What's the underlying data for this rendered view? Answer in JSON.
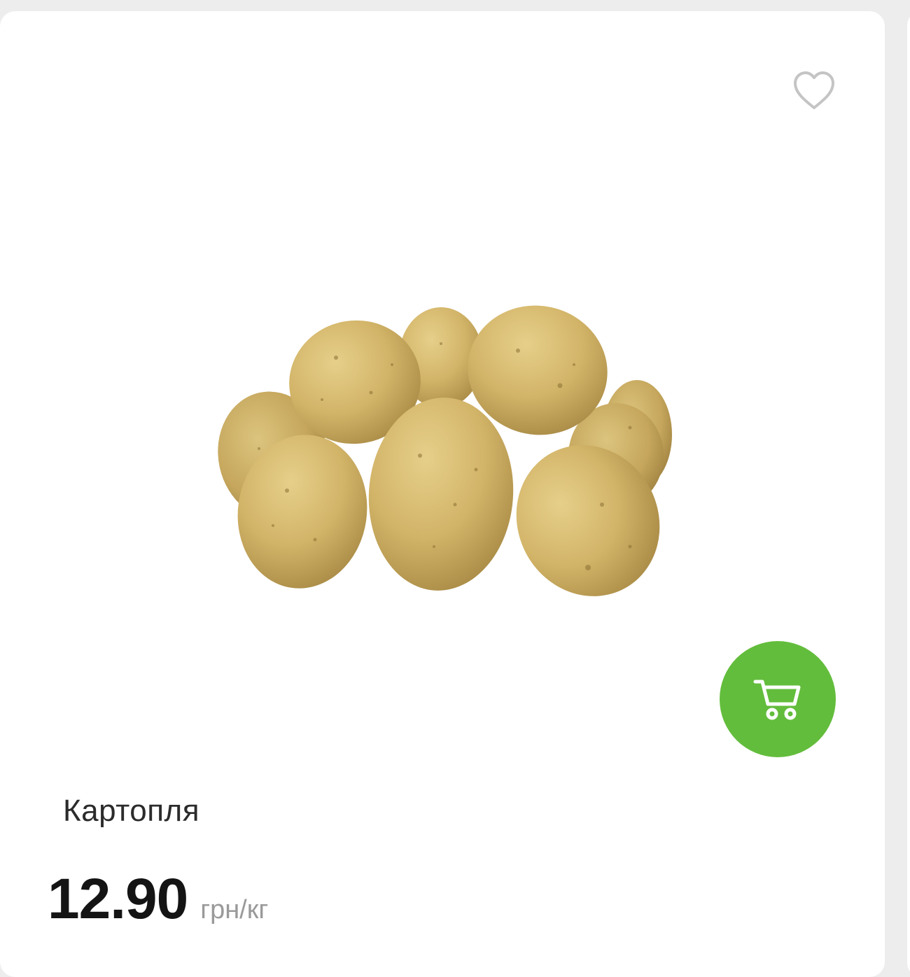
{
  "product": {
    "name": "Картопля",
    "price": "12.90",
    "unit": "грн/кг",
    "image_icon": "potatoes-image"
  },
  "actions": {
    "favorite_icon": "heart-outline-icon",
    "cart_icon": "shopping-cart-icon"
  },
  "colors": {
    "accent": "#63bd3c",
    "card_background": "#ffffff",
    "page_background": "#ededed"
  }
}
